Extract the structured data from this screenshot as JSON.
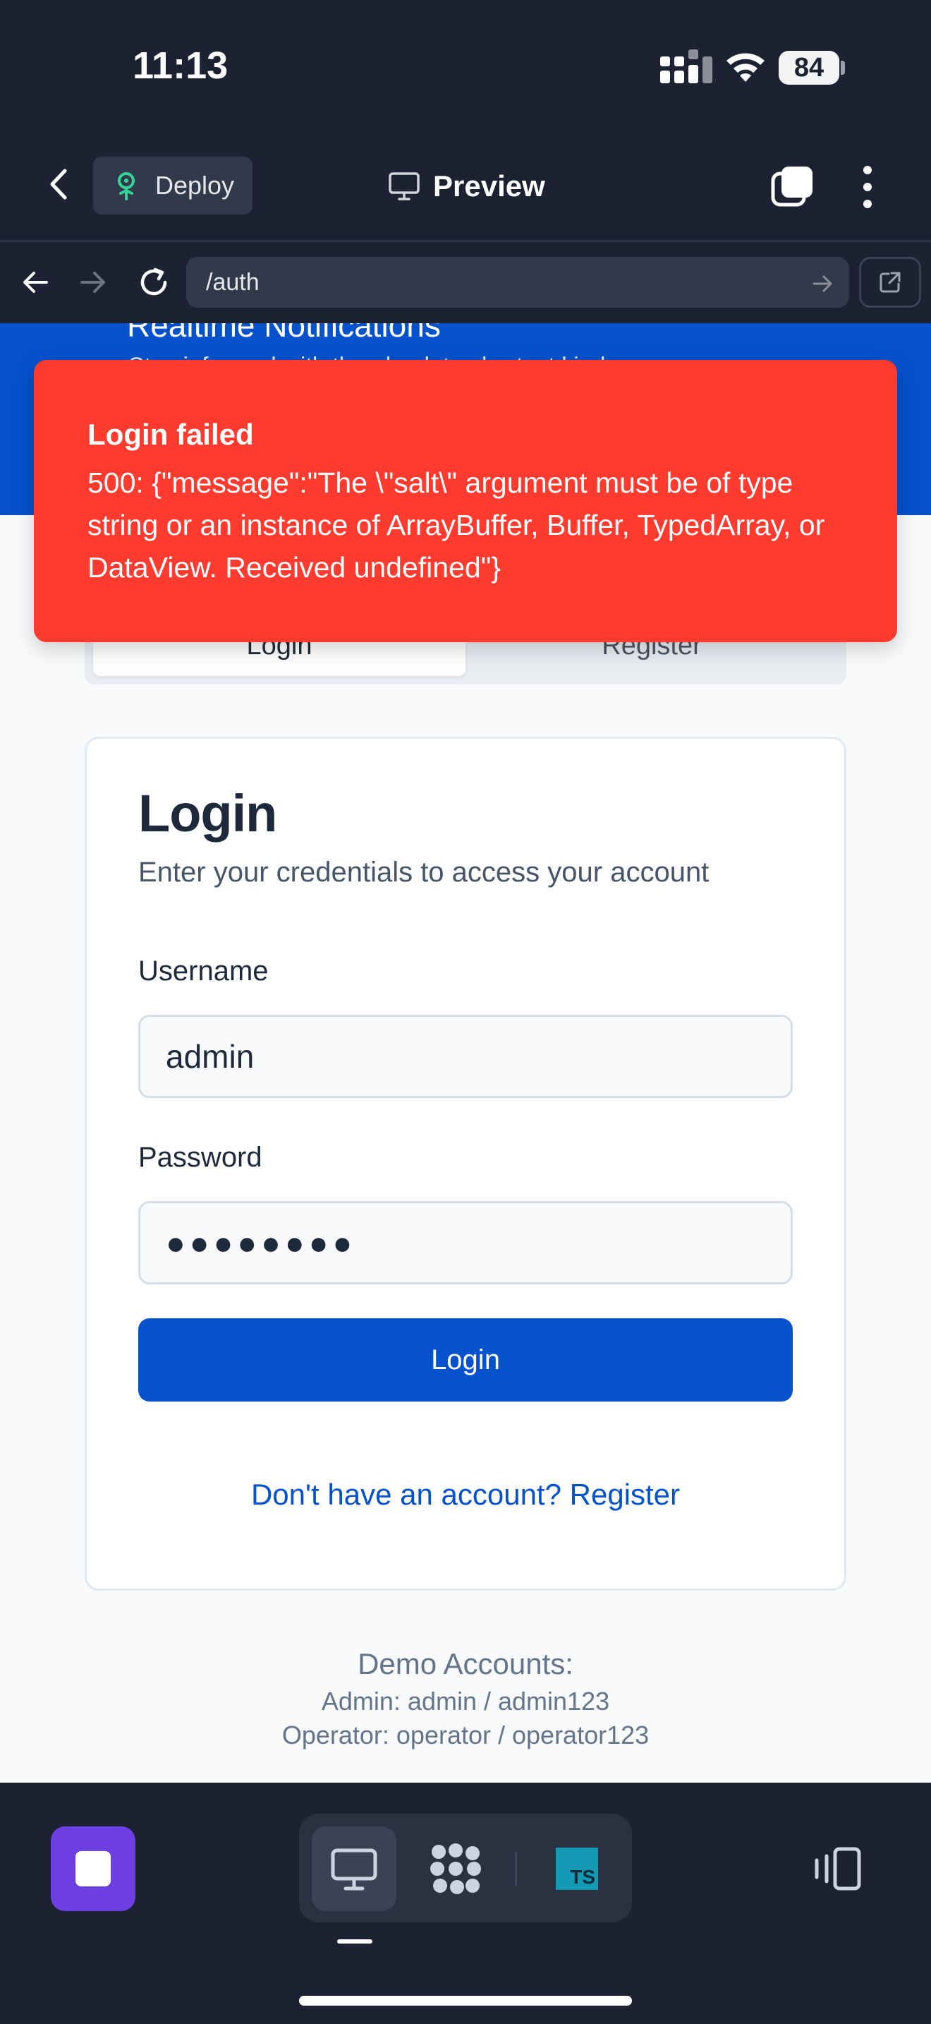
{
  "status_bar": {
    "time": "11:13",
    "battery": "84",
    "icons": [
      "cellular-signal-icon",
      "wifi-icon",
      "battery-icon"
    ]
  },
  "top_nav": {
    "deploy_label": "Deploy",
    "preview_label": "Preview"
  },
  "url_bar": {
    "path": "/auth"
  },
  "hero": {
    "title": "Realtime Notifications",
    "subtitle": "Stay informed with the absolute shortest kind"
  },
  "toast": {
    "title": "Login failed",
    "message": "500: {\"message\":\"The \\\"salt\\\" argument must be of type string or an instance of ArrayBuffer, Buffer, TypedArray, or DataView. Received undefined\"}"
  },
  "tabs": {
    "login": "Login",
    "register": "Register"
  },
  "login_card": {
    "title": "Login",
    "description": "Enter your credentials to access your account",
    "username_label": "Username",
    "username_value": "admin",
    "password_label": "Password",
    "password_value": "●●●●●●●●",
    "submit_label": "Login",
    "register_link": "Don't have an account? Register"
  },
  "demo_accounts": {
    "title": "Demo Accounts:",
    "admin": "Admin: admin / admin123",
    "operator": "Operator: operator / operator123"
  },
  "bottom_bar": {
    "ts_badge": "TS"
  },
  "colors": {
    "chrome_bg": "#1c2232",
    "brand_blue": "#0552cc",
    "error_red": "#ff3b30",
    "stop_purple": "#6d3ee0"
  }
}
